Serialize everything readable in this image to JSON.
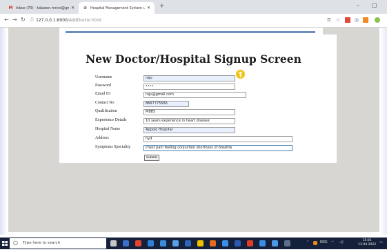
{
  "browser": {
    "tabs": [
      {
        "title": "Inbox (70) - kalaeen.mnnd@gmai",
        "favicon": "gmail-icon",
        "active": false
      },
      {
        "title": "Hospital Management System u",
        "favicon": "globe-icon",
        "active": true
      }
    ],
    "new_tab": "+",
    "window_controls": {
      "minimize": "–",
      "maximize": "▢"
    },
    "address": {
      "host": "127.0.0.1:8000",
      "path": "/AddDoctor.html"
    }
  },
  "page": {
    "title": "New Doctor/Hospital Signup Screen",
    "fields": [
      {
        "label": "Username",
        "value": "raju"
      },
      {
        "label": "Password",
        "value": "••••"
      },
      {
        "label": "Email ID",
        "value": "raju@gmail.com"
      },
      {
        "label": "Contact No",
        "value": "8667775566"
      },
      {
        "label": "Qualification",
        "value": "MBBS"
      },
      {
        "label": "Experience Details",
        "value": "10 years experience in heart disease"
      },
      {
        "label": "Hospital Name",
        "value": "Appolo Hospital"
      },
      {
        "label": "Address",
        "value": "hyd"
      },
      {
        "label": "Symptoms Speciality",
        "value": "chest pain feeling conjuction shortness of breathe"
      }
    ],
    "submit_label": "Submit"
  },
  "taskbar": {
    "search_placeholder": "Type here to search",
    "clock_time": "15:01",
    "clock_date": "13-04-2022",
    "tray_text": "ENG"
  },
  "colors": {
    "tab_strip": "#dee1e6",
    "page_background": "#d8d6d3",
    "header_bar": "#6b8fba",
    "autofill": "#e8f0fe",
    "taskbar": "#15213a",
    "key_icon": "#f0c419"
  }
}
